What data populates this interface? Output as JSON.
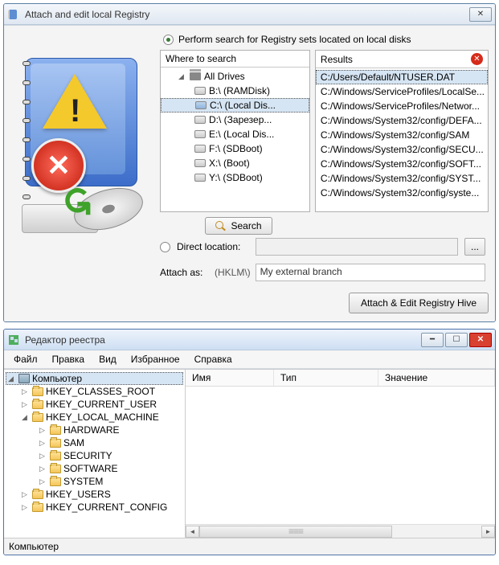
{
  "dialog": {
    "title": "Attach and edit local Registry",
    "radio1_label": "Perform search for Registry sets located on local disks",
    "radio2_label": "Direct location:",
    "where_header": "Where to search",
    "results_header": "Results",
    "all_drives": "All Drives",
    "drives": [
      {
        "label": "B:\\  (RAMDisk)",
        "sel": false
      },
      {
        "label": "C:\\  (Local Dis...",
        "sel": true
      },
      {
        "label": "D:\\  (Зарезер...",
        "sel": false
      },
      {
        "label": "E:\\  (Local Dis...",
        "sel": false
      },
      {
        "label": "F:\\  (SDBoot)",
        "sel": false
      },
      {
        "label": "X:\\  (Boot)",
        "sel": false
      },
      {
        "label": "Y:\\  (SDBoot)",
        "sel": false
      }
    ],
    "results": [
      {
        "path": "C:/Users/Default/NTUSER.DAT",
        "sel": true
      },
      {
        "path": "C:/Windows/ServiceProfiles/LocalSe...",
        "sel": false
      },
      {
        "path": "C:/Windows/ServiceProfiles/Networ...",
        "sel": false
      },
      {
        "path": "C:/Windows/System32/config/DEFA...",
        "sel": false
      },
      {
        "path": "C:/Windows/System32/config/SAM",
        "sel": false
      },
      {
        "path": "C:/Windows/System32/config/SECU...",
        "sel": false
      },
      {
        "path": "C:/Windows/System32/config/SOFT...",
        "sel": false
      },
      {
        "path": "C:/Windows/System32/config/SYST...",
        "sel": false
      },
      {
        "path": "C:/Windows/System32/config/syste...",
        "sel": false
      }
    ],
    "search_btn": "Search",
    "direct_location_value": "",
    "browse_label": "...",
    "attach_as_label": "Attach as:",
    "attach_as_prefix": "(HKLM\\)",
    "attach_as_value": "My external branch",
    "attach_btn": "Attach & Edit Registry Hive"
  },
  "regedit": {
    "title": "Редактор реестра",
    "menu": [
      "Файл",
      "Правка",
      "Вид",
      "Избранное",
      "Справка"
    ],
    "columns": [
      "Имя",
      "Тип",
      "Значение"
    ],
    "tree": [
      {
        "label": "Компьютер",
        "depth": 0,
        "open": true,
        "icon": "comp",
        "sel": true
      },
      {
        "label": "HKEY_CLASSES_ROOT",
        "depth": 1,
        "open": false,
        "icon": "fold"
      },
      {
        "label": "HKEY_CURRENT_USER",
        "depth": 1,
        "open": false,
        "icon": "fold"
      },
      {
        "label": "HKEY_LOCAL_MACHINE",
        "depth": 1,
        "open": true,
        "icon": "fold"
      },
      {
        "label": "HARDWARE",
        "depth": 2,
        "open": false,
        "icon": "fold"
      },
      {
        "label": "SAM",
        "depth": 2,
        "open": false,
        "icon": "fold"
      },
      {
        "label": "SECURITY",
        "depth": 2,
        "open": false,
        "icon": "fold"
      },
      {
        "label": "SOFTWARE",
        "depth": 2,
        "open": false,
        "icon": "fold"
      },
      {
        "label": "SYSTEM",
        "depth": 2,
        "open": false,
        "icon": "fold"
      },
      {
        "label": "HKEY_USERS",
        "depth": 1,
        "open": false,
        "icon": "fold"
      },
      {
        "label": "HKEY_CURRENT_CONFIG",
        "depth": 1,
        "open": false,
        "icon": "fold"
      }
    ],
    "status": "Компьютер"
  }
}
